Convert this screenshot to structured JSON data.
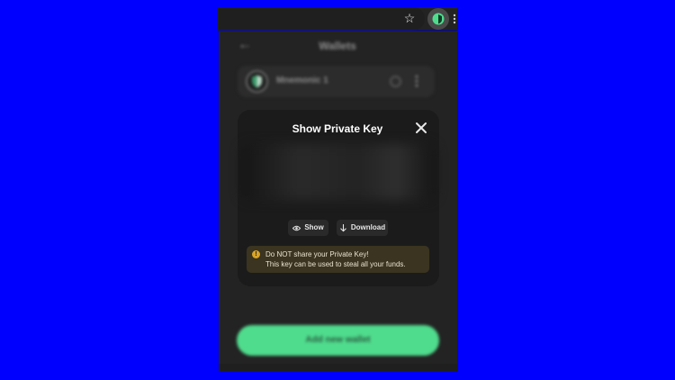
{
  "browser": {
    "bookmark_icon": "star-icon",
    "extension_icon": "wallet-extension-icon",
    "menu_icon": "kebab-icon"
  },
  "popup": {
    "header": {
      "back_icon": "arrow-left-icon",
      "title": "Wallets"
    },
    "wallet": {
      "name": "Mnemonic 1",
      "icon": "shield-icon"
    },
    "modal": {
      "title": "Show Private Key",
      "close_icon": "close-icon",
      "show_label": "Show",
      "download_label": "Download",
      "warning": {
        "line1": "Do NOT share your Private Key!",
        "line2": "This key can be used to steal all your funds."
      }
    },
    "add_wallet_label": "Add new wallet"
  },
  "colors": {
    "accent": "#4fdc8d",
    "background": "#0000ff",
    "popup_bg": "#232323",
    "warning_bg": "#3a3420",
    "warning_icon": "#d9a426"
  }
}
